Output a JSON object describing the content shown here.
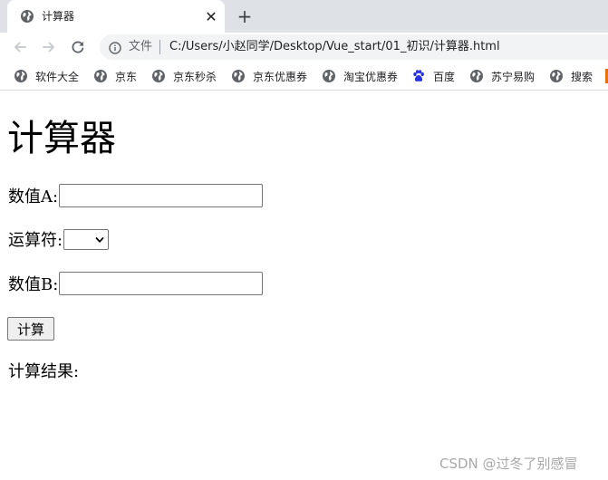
{
  "browser": {
    "tab": {
      "title": "计算器",
      "close_glyph": "✕",
      "favicon": "globe-icon"
    },
    "new_tab_glyph": "+",
    "toolbar": {
      "back": "back-arrow-icon",
      "forward": "forward-arrow-icon",
      "reload": "reload-icon",
      "site_label": "文件",
      "url": "C:/Users/小赵同学/Desktop/Vue_start/01_初识/计算器.html"
    },
    "bookmarks": [
      {
        "label": "软件大全",
        "icon": "globe-icon"
      },
      {
        "label": "京东",
        "icon": "globe-icon"
      },
      {
        "label": "京东秒杀",
        "icon": "globe-icon"
      },
      {
        "label": "京东优惠券",
        "icon": "globe-icon"
      },
      {
        "label": "淘宝优惠券",
        "icon": "globe-icon"
      },
      {
        "label": "百度",
        "icon": "baidu-paw-icon"
      },
      {
        "label": "苏宁易购",
        "icon": "globe-icon"
      },
      {
        "label": "搜索",
        "icon": "globe-icon"
      }
    ]
  },
  "page": {
    "title": "计算器",
    "field_a": {
      "label": "数值A:",
      "value": ""
    },
    "operator": {
      "label": "运算符:",
      "selected": ""
    },
    "field_b": {
      "label": "数值B:",
      "value": ""
    },
    "calc_button": "计算",
    "result_label": "计算结果:",
    "result_value": ""
  },
  "watermark": "CSDN @过冬了别感冒",
  "colors": {
    "tabstrip_bg": "#dee1e6",
    "omnibox_bg": "#f1f3f4",
    "baidu_blue": "#2932e1",
    "overflow_orange": "#e8710a"
  }
}
